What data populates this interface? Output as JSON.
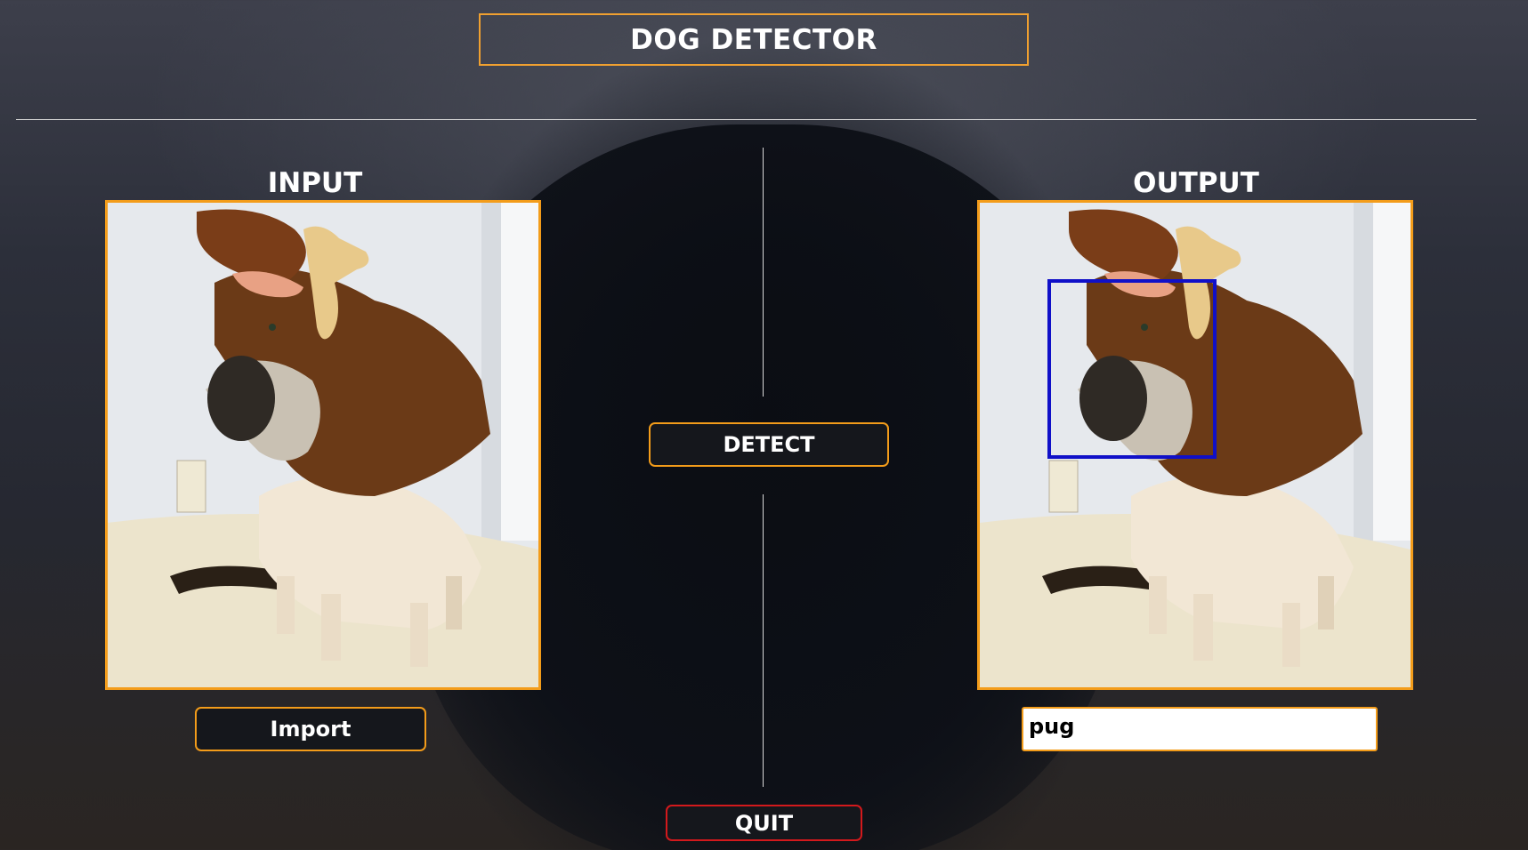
{
  "app": {
    "title": "DOG DETECTOR"
  },
  "input": {
    "label": "INPUT",
    "image_icon": "pug-in-moose-costume-image"
  },
  "output": {
    "label": "OUTPUT",
    "image_icon": "pug-in-moose-costume-image",
    "detection_box_color": "#1010c8",
    "result_value": "pug"
  },
  "buttons": {
    "detect": "DETECT",
    "import": "Import",
    "quit": "QUIT"
  },
  "colors": {
    "accent": "#f39c1a",
    "quit_border": "#d3191c"
  }
}
